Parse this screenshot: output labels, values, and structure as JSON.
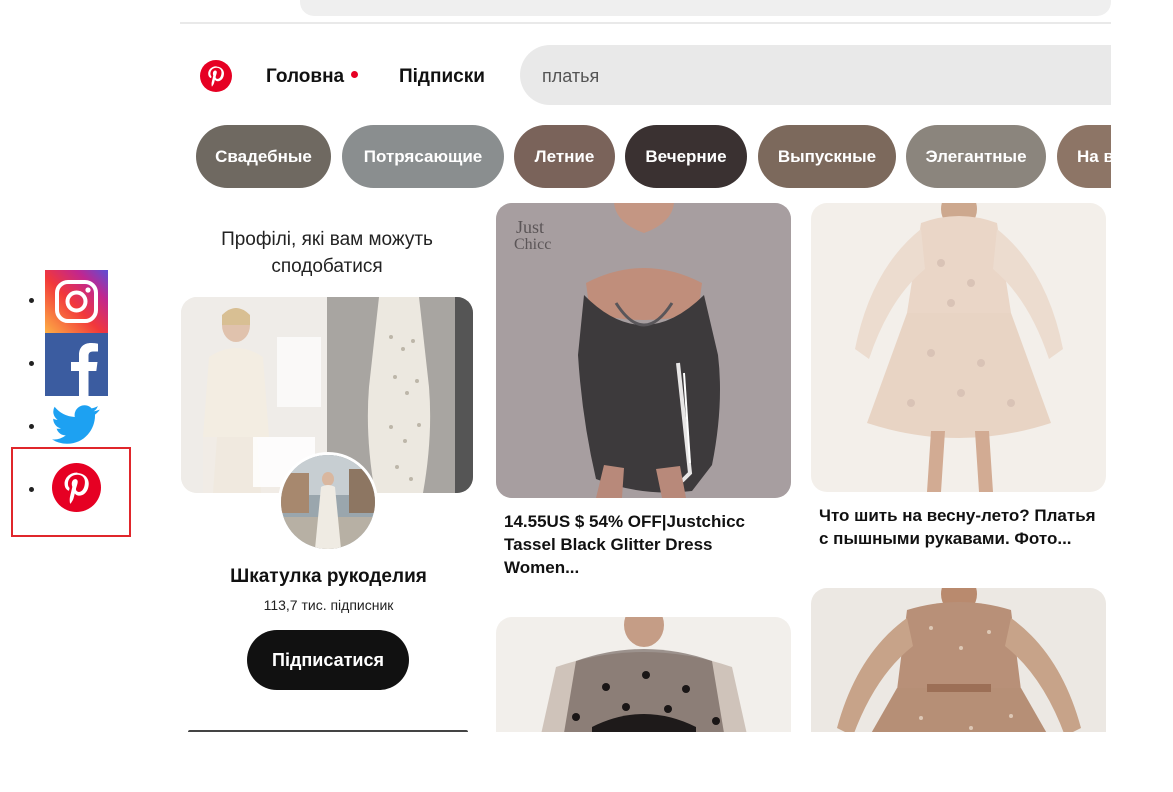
{
  "header": {
    "nav_home": "Головна",
    "nav_subscriptions": "Підписки",
    "search_value": "платья"
  },
  "chips": [
    {
      "label": "Свадебные",
      "color": "#6f6961"
    },
    {
      "label": "Потрясающие",
      "color": "#8a8e8f"
    },
    {
      "label": "Летние",
      "color": "#7a635a"
    },
    {
      "label": "Вечерние",
      "color": "#3a3131"
    },
    {
      "label": "Выпускные",
      "color": "#7c695c"
    },
    {
      "label": "Элегантные",
      "color": "#8b857d"
    },
    {
      "label": "На в",
      "color": "#8d7566"
    }
  ],
  "profile": {
    "section_title": "Профілі, які вам можуть сподобатися",
    "name": "Шкатулка рукоделия",
    "subscribers": "113,7 тис. підписник",
    "follow_label": "Підписатися"
  },
  "pins": [
    {
      "title": "14.55US $ 54% OFF|Justchicc Tassel Black Glitter Dress Women..."
    },
    {
      "title": "Что шить на весну-лето? Платья с пышными рукавами. Фото..."
    }
  ],
  "social_icons": [
    "instagram-icon",
    "facebook-icon",
    "twitter-icon",
    "pinterest-icon"
  ],
  "colors": {
    "brand_red": "#e60023",
    "highlight_border": "#e0262b"
  }
}
